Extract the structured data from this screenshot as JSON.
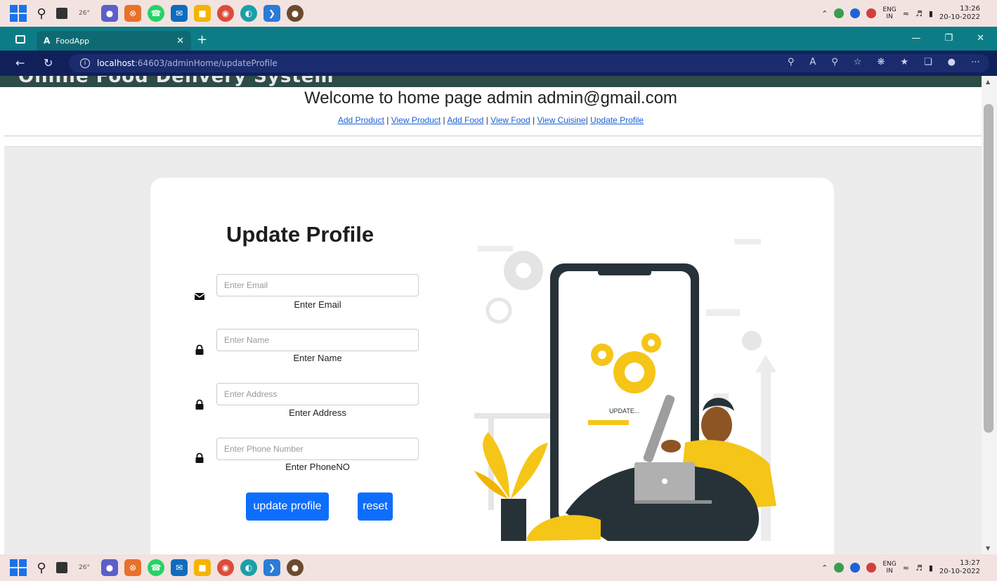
{
  "taskbar": {
    "weather_temp": "26°",
    "lang_top": "ENG",
    "lang_bottom": "IN",
    "top_time": "13:26",
    "top_date": "20-10-2022",
    "bottom_time": "13:27",
    "bottom_date": "20-10-2022"
  },
  "browser": {
    "tab_title": "FoodApp",
    "tab_favicon": "A",
    "url_host": "localhost",
    "url_path": ":64603/adminHome/updateProfile"
  },
  "page": {
    "site_title": "Online Food Delivery System",
    "welcome": "Welcome to home page admin admin@gmail.com",
    "nav": [
      {
        "label": "Add Product"
      },
      {
        "label": "View Product"
      },
      {
        "label": "Add Food"
      },
      {
        "label": "View Food"
      },
      {
        "label": "View Cuisine"
      },
      {
        "label": "Update Profile"
      }
    ]
  },
  "form": {
    "title": "Update Profile",
    "fields": [
      {
        "icon": "envelope-icon",
        "placeholder": "Enter Email",
        "label": "Enter Email"
      },
      {
        "icon": "lock-icon",
        "placeholder": "Enter Name",
        "label": "Enter Name"
      },
      {
        "icon": "lock-icon",
        "placeholder": "Enter Address",
        "label": "Enter Address"
      },
      {
        "icon": "lock-icon",
        "placeholder": "Enter Phone Number",
        "label": "Enter PhoneNO"
      }
    ],
    "submit_label": "update profile",
    "reset_label": "reset"
  },
  "illustration": {
    "status_text": "UPDATE..."
  },
  "colors": {
    "primary_button": "#0d6efd",
    "tab_bar": "#0c7d86",
    "address_bar": "#11205b",
    "header_band": "#2d4b47",
    "accent_yellow": "#f5c518"
  }
}
